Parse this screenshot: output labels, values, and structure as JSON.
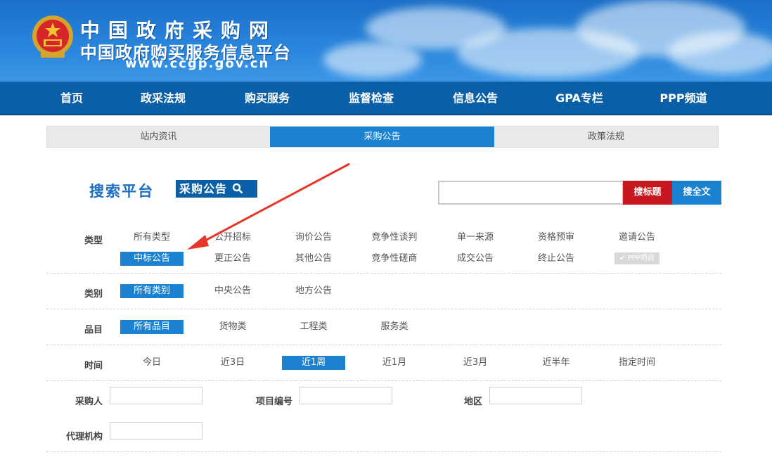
{
  "header": {
    "title": "中国政府采购网",
    "subtitle": "中国政府购买服务信息平台",
    "url": "www.ccgp.gov.cn"
  },
  "nav": [
    "首页",
    "政采法规",
    "购买服务",
    "监督检查",
    "信息公告",
    "GPA专栏",
    "PPP频道"
  ],
  "tabs": [
    {
      "label": "站内资讯",
      "active": false
    },
    {
      "label": "采购公告",
      "active": true
    },
    {
      "label": "政策法规",
      "active": false
    }
  ],
  "search": {
    "platform_title": "搜索平台",
    "badge": "采购公告",
    "query": "",
    "btn_title": "搜标题",
    "btn_fulltext": "搜全文"
  },
  "filters": {
    "type": {
      "label": "类型",
      "row1": [
        "所有类型",
        "公开招标",
        "询价公告",
        "竞争性谈判",
        "单一来源",
        "资格预审",
        "邀请公告"
      ],
      "row2": [
        "中标公告",
        "更正公告",
        "其他公告",
        "竞争性磋商",
        "成交公告",
        "终止公告"
      ],
      "selected": "中标公告",
      "ppp": "✔ PPP项目"
    },
    "category": {
      "label": "类别",
      "options": [
        "所有类别",
        "中央公告",
        "地方公告"
      ],
      "selected": "所有类别"
    },
    "item": {
      "label": "品目",
      "options": [
        "所有品目",
        "货物类",
        "工程类",
        "服务类"
      ],
      "selected": "所有品目"
    },
    "time": {
      "label": "时间",
      "options": [
        "今日",
        "近3日",
        "近1周",
        "近1月",
        "近3月",
        "近半年",
        "指定时间"
      ],
      "selected": "近1周"
    }
  },
  "fields": {
    "buyer": {
      "label": "采购人",
      "value": ""
    },
    "project_no": {
      "label": "项目编号",
      "value": ""
    },
    "region": {
      "label": "地区",
      "value": ""
    },
    "agency": {
      "label": "代理机构",
      "value": ""
    }
  },
  "colors": {
    "brand_blue": "#0a5fa7",
    "accent_blue": "#1a82d0",
    "red": "#c8171f",
    "arrow": "#e8372a"
  }
}
